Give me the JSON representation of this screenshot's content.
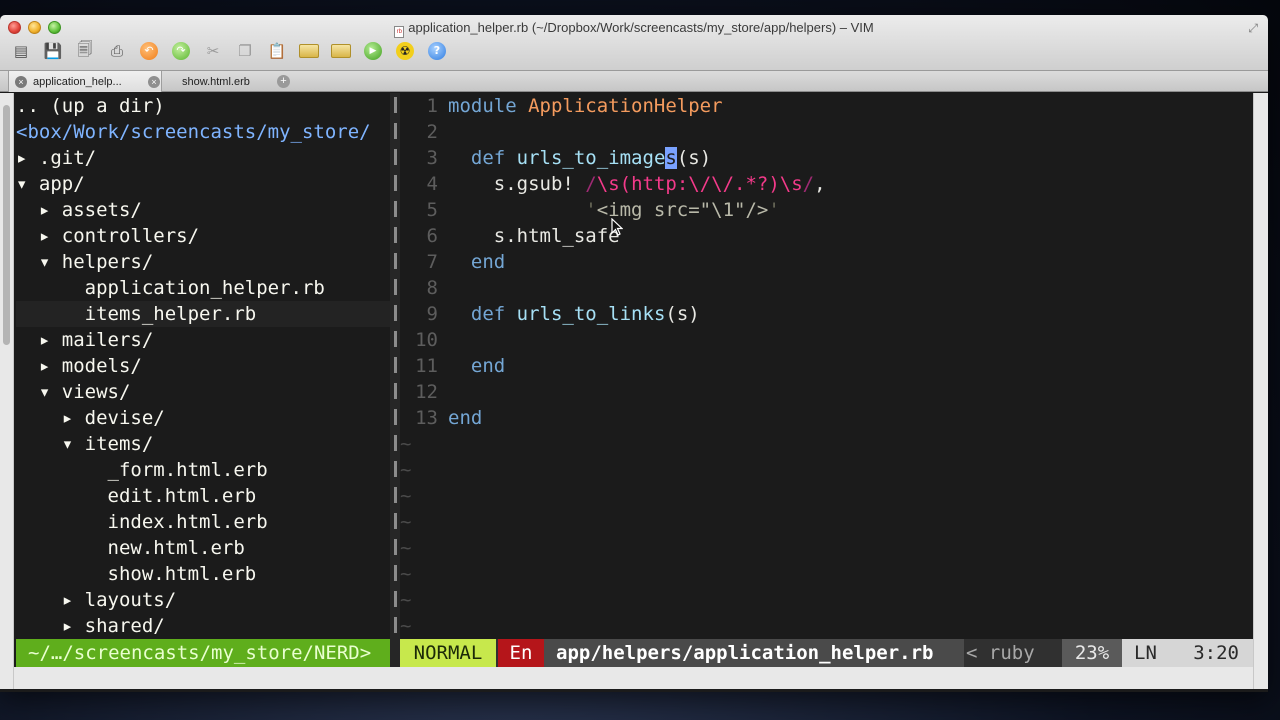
{
  "window": {
    "title": "application_helper.rb (~/Dropbox/Work/screencasts/my_store/app/helpers) – VIM",
    "file_badge": "rb"
  },
  "toolbar": {
    "icons": [
      "open-file-icon",
      "save-icon",
      "save-all-icon",
      "print-icon",
      "undo-icon",
      "redo-icon",
      "cut-icon",
      "copy-icon",
      "paste-icon",
      "find-folder-icon",
      "new-folder-icon",
      "run-icon",
      "build-icon",
      "help-icon"
    ]
  },
  "tabs": [
    {
      "label": "application_help...",
      "active": true
    },
    {
      "label": "show.html.erb",
      "active": false
    }
  ],
  "nerdtree": {
    "updir": ".. (up a dir)",
    "root": "<box/Work/screencasts/my_store/",
    "rows": [
      {
        "arrow": "▸",
        "name": ".git/",
        "indent": 0
      },
      {
        "arrow": "▾",
        "name": "app/",
        "indent": 0
      },
      {
        "arrow": "▸",
        "name": "assets/",
        "indent": 1
      },
      {
        "arrow": "▸",
        "name": "controllers/",
        "indent": 1
      },
      {
        "arrow": "▾",
        "name": "helpers/",
        "indent": 1
      },
      {
        "arrow": "",
        "name": "application_helper.rb",
        "indent": 2
      },
      {
        "arrow": "",
        "name": "items_helper.rb",
        "indent": 2,
        "current": true
      },
      {
        "arrow": "▸",
        "name": "mailers/",
        "indent": 1
      },
      {
        "arrow": "▸",
        "name": "models/",
        "indent": 1
      },
      {
        "arrow": "▾",
        "name": "views/",
        "indent": 1
      },
      {
        "arrow": "▸",
        "name": "devise/",
        "indent": 2
      },
      {
        "arrow": "▾",
        "name": "items/",
        "indent": 2
      },
      {
        "arrow": "",
        "name": "_form.html.erb",
        "indent": 3
      },
      {
        "arrow": "",
        "name": "edit.html.erb",
        "indent": 3
      },
      {
        "arrow": "",
        "name": "index.html.erb",
        "indent": 3
      },
      {
        "arrow": "",
        "name": "new.html.erb",
        "indent": 3
      },
      {
        "arrow": "",
        "name": "show.html.erb",
        "indent": 3
      },
      {
        "arrow": "▸",
        "name": "layouts/",
        "indent": 2
      },
      {
        "arrow": "▸",
        "name": "shared/",
        "indent": 2
      }
    ]
  },
  "code": {
    "line_numbers": [
      "1",
      "2",
      "3",
      "4",
      "5",
      "6",
      "7",
      "8",
      "9",
      "10",
      "11",
      "12",
      "13"
    ],
    "l1_kw": "module",
    "l1_name": "ApplicationHelper",
    "l3_kw": "def",
    "l3_fn_a": "urls_to_image",
    "l3_cursor": "s",
    "l3_args": "(s)",
    "l4_recv": "s.gsub!",
    "l4_re_open": "/",
    "l4_re_body": "\\s(http:\\/\\/.*?)\\s",
    "l4_re_close": "/",
    "l4_comma": ",",
    "l5_q1": "'",
    "l5_str": "<img src=\"\\1\"/>",
    "l5_q2": "'",
    "l6_text": "s.html_safe",
    "l7_kw": "end",
    "l9_kw": "def",
    "l9_fn": "urls_to_links",
    "l9_args": "(s)",
    "l11_kw": "end",
    "l13_kw": "end",
    "tilde": "~"
  },
  "statusline": {
    "nerd_path": "~/…/screencasts/my_store/NERD>",
    "mode": "NORMAL",
    "encoding": "En",
    "file": "app/helpers/application_helper.rb",
    "filetype": "< ruby",
    "percent": "23%",
    "ln_label": "LN",
    "position": "3:20"
  },
  "colors": {
    "mode_bg": "#c7e84c",
    "nerd_bg": "#5fae1c",
    "encoding_bg": "#b5151a",
    "keyword": "#74a6d4",
    "module_name": "#f49b5e",
    "regex": "#f33a8a"
  }
}
